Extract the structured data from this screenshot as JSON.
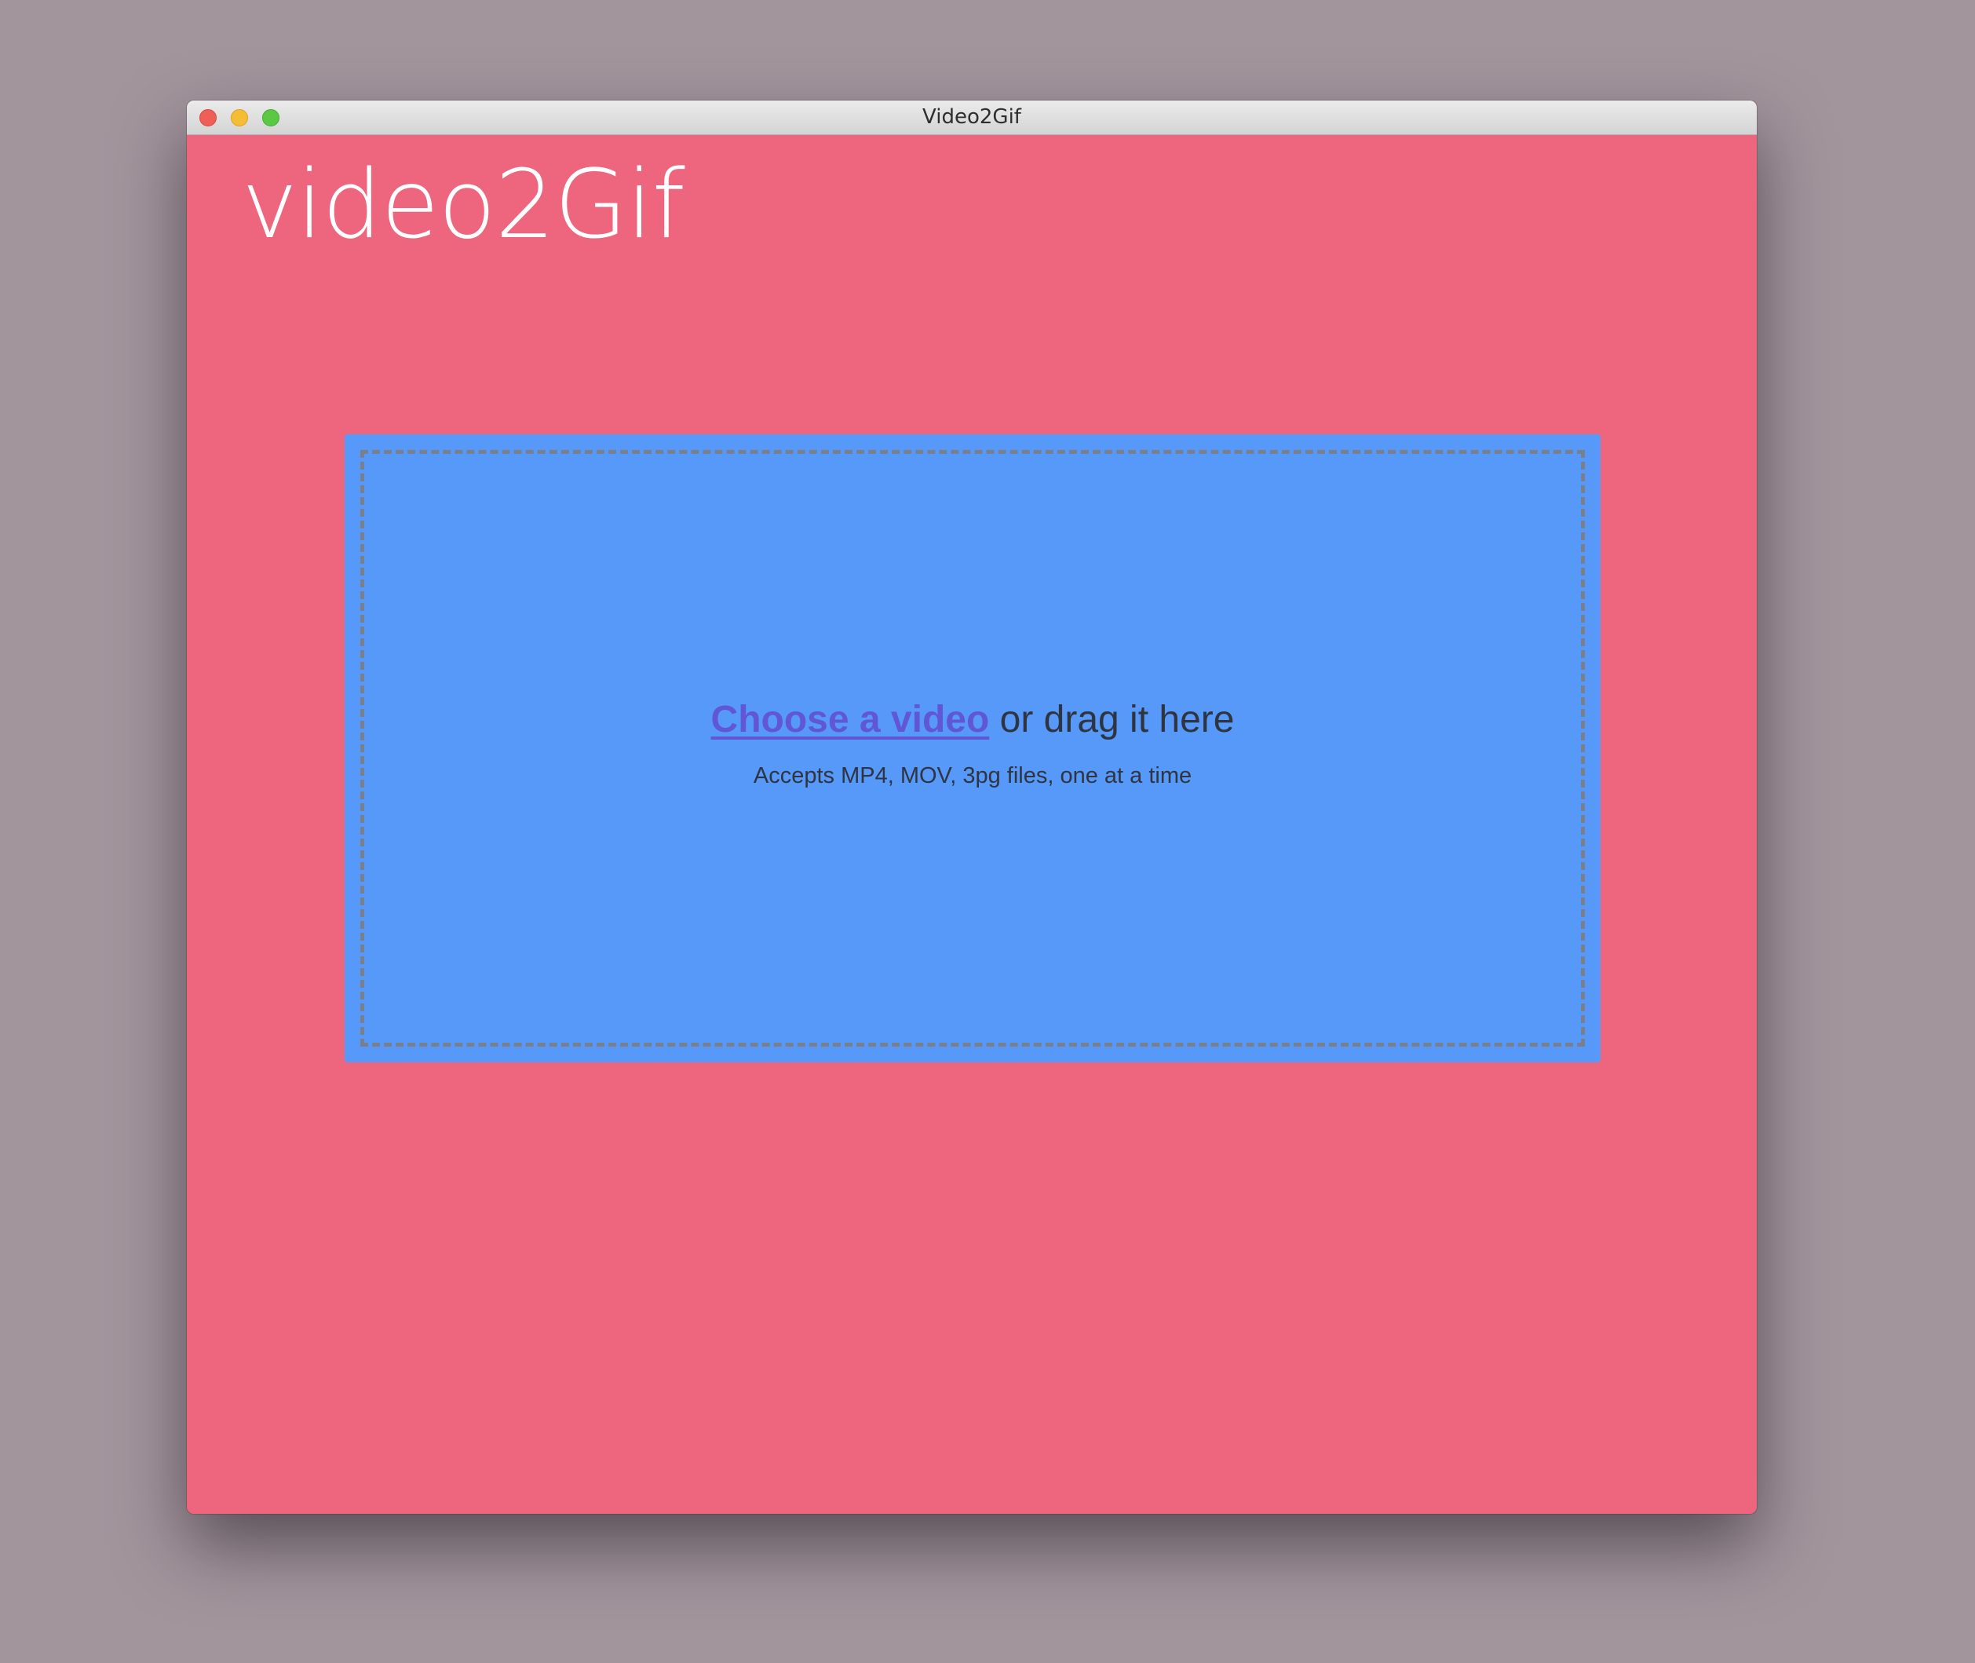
{
  "window": {
    "title": "Video2Gif"
  },
  "app": {
    "logo": "video2Gif"
  },
  "dropzone": {
    "link_label": "Choose a video",
    "rest_label": " or drag it here",
    "hint": "Accepts MP4, MOV, 3pg files, one at a time"
  },
  "colors": {
    "desktop": "#a3959c",
    "app_background": "#ee657e",
    "dropzone_background": "#5799f8",
    "link": "#6056d6"
  }
}
